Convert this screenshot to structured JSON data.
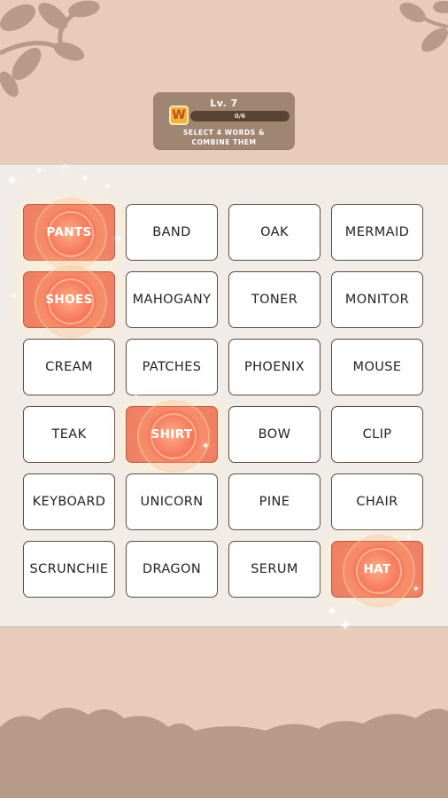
{
  "level": {
    "label": "Lv. 7"
  },
  "badge": {
    "letter": "W"
  },
  "progress": {
    "text": "0/6",
    "value": 0,
    "max": 6
  },
  "instruction": {
    "line1": "SELECT 4 WORDS &",
    "line2": "COMBINE THEM"
  },
  "colors": {
    "background": "#e8cbbb",
    "board": "#f1ece8",
    "selected_tile": "#f18366",
    "tile_border": "#5d4a40",
    "decor": "#b89a88"
  },
  "tiles": [
    {
      "word": "PANTS",
      "selected": true
    },
    {
      "word": "BAND",
      "selected": false
    },
    {
      "word": "OAK",
      "selected": false
    },
    {
      "word": "MERMAID",
      "selected": false
    },
    {
      "word": "SHOES",
      "selected": true
    },
    {
      "word": "MAHOGANY",
      "selected": false
    },
    {
      "word": "TONER",
      "selected": false
    },
    {
      "word": "MONITOR",
      "selected": false
    },
    {
      "word": "CREAM",
      "selected": false
    },
    {
      "word": "PATCHES",
      "selected": false
    },
    {
      "word": "PHOENIX",
      "selected": false
    },
    {
      "word": "MOUSE",
      "selected": false
    },
    {
      "word": "TEAK",
      "selected": false
    },
    {
      "word": "SHIRT",
      "selected": true
    },
    {
      "word": "BOW",
      "selected": false
    },
    {
      "word": "CLIP",
      "selected": false
    },
    {
      "word": "KEYBOARD",
      "selected": false
    },
    {
      "word": "UNICORN",
      "selected": false
    },
    {
      "word": "PINE",
      "selected": false
    },
    {
      "word": "CHAIR",
      "selected": false
    },
    {
      "word": "SCRUNCHIE",
      "selected": false
    },
    {
      "word": "DRAGON",
      "selected": false
    },
    {
      "word": "SERUM",
      "selected": false
    },
    {
      "word": "HAT",
      "selected": true
    }
  ]
}
